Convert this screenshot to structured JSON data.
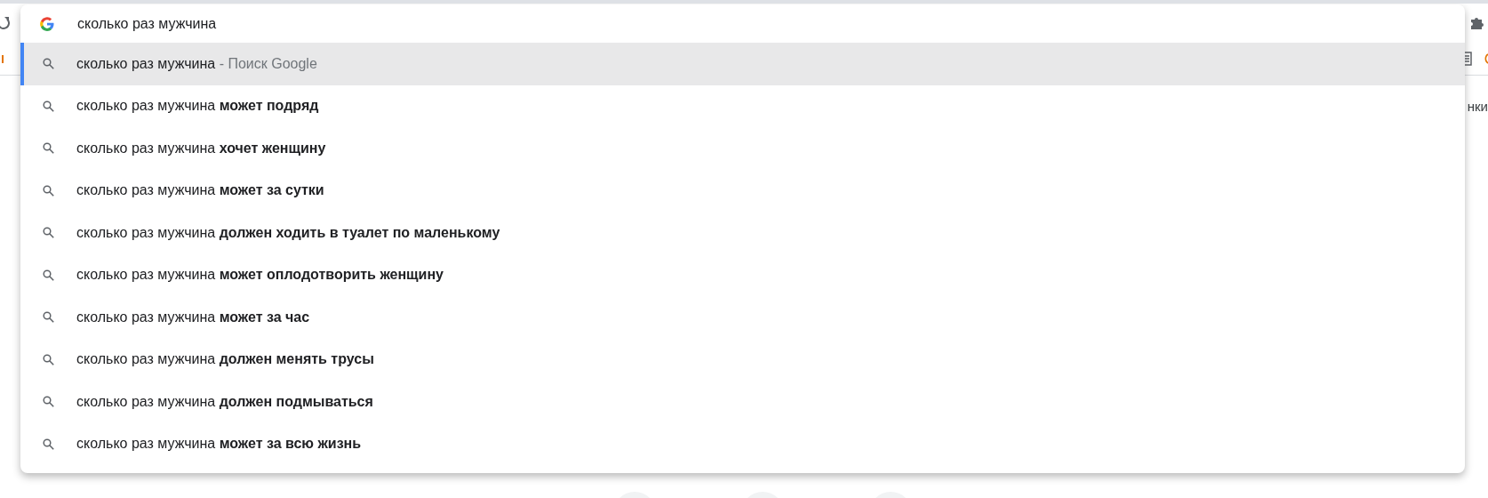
{
  "omnibox": {
    "value": "сколько раз мужчина"
  },
  "suggestions": [
    {
      "kind": "search",
      "text": "сколько раз мужчина",
      "hint": "- Поиск Google",
      "selected": true
    },
    {
      "kind": "completion",
      "text": "сколько раз мужчина **может подряд**",
      "selected": false
    },
    {
      "kind": "completion",
      "text": "сколько раз мужчина **хочет женщину**",
      "selected": false
    },
    {
      "kind": "completion",
      "text": "сколько раз мужчина **может за сутки**",
      "selected": false
    },
    {
      "kind": "completion",
      "text": "сколько раз мужчина **должен ходить в туалет по маленькому**",
      "selected": false
    },
    {
      "kind": "completion",
      "text": "сколько раз мужчина **может оплодотворить женщину**",
      "selected": false
    },
    {
      "kind": "completion",
      "text": "сколько раз мужчина **может за час**",
      "selected": false
    },
    {
      "kind": "completion",
      "text": "сколько раз мужчина **должен менять трусы**",
      "selected": false
    },
    {
      "kind": "completion",
      "text": "сколько раз мужчина **должен подмываться**",
      "selected": false
    },
    {
      "kind": "completion",
      "text": "сколько раз мужчина **может за всю жизнь**",
      "selected": false
    }
  ],
  "page": {
    "partial_text": "нки"
  }
}
